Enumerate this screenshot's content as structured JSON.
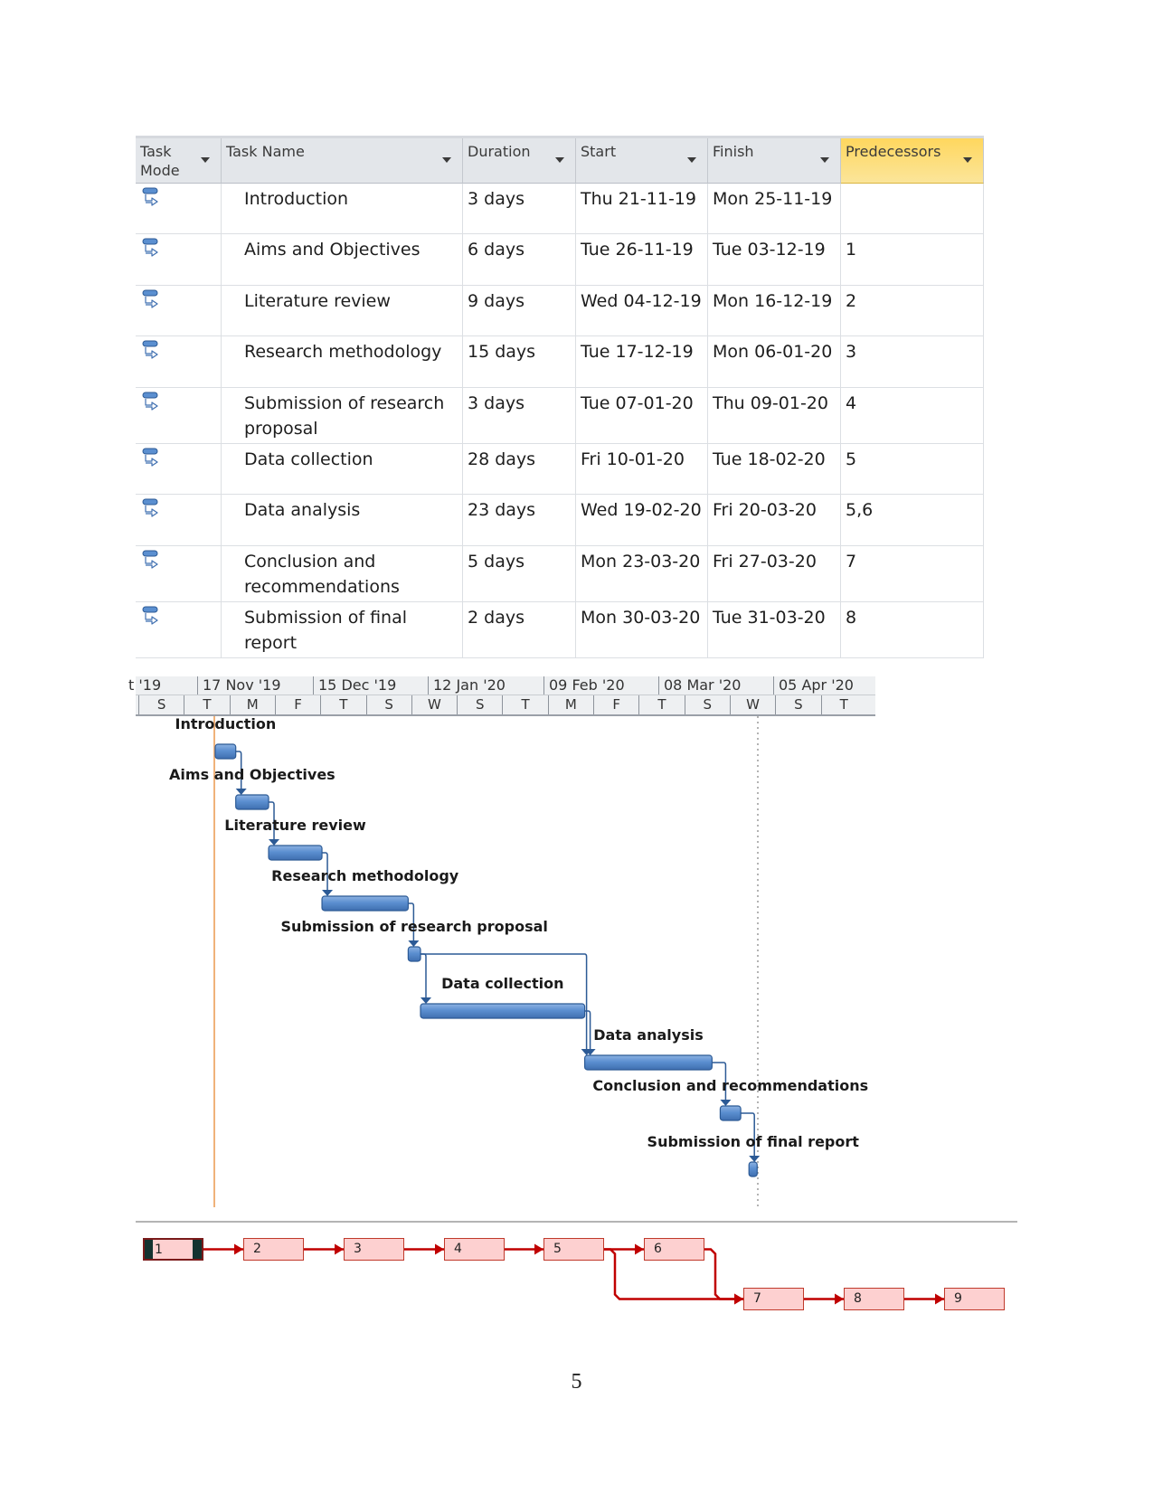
{
  "table": {
    "columns": [
      {
        "key": "mode",
        "label": "Task Mode"
      },
      {
        "key": "name",
        "label": "Task Name"
      },
      {
        "key": "duration",
        "label": "Duration"
      },
      {
        "key": "start",
        "label": "Start"
      },
      {
        "key": "finish",
        "label": "Finish"
      },
      {
        "key": "predecessors",
        "label": "Predecessors"
      }
    ],
    "header_labels": {
      "mode_line1": "Task",
      "mode_line2": "Mode",
      "name": "Task Name",
      "duration": "Duration",
      "start": "Start",
      "finish": "Finish",
      "predecessors": "Predecessors"
    },
    "rows": [
      {
        "id": 1,
        "mode": "auto-scheduled-task-icon",
        "name": "Introduction",
        "duration": "3 days",
        "start": "Thu 21-11-19",
        "finish": "Mon 25-11-19",
        "predecessors": ""
      },
      {
        "id": 2,
        "mode": "auto-scheduled-task-icon",
        "name": "Aims and Objectives",
        "duration": "6 days",
        "start": "Tue 26-11-19",
        "finish": "Tue 03-12-19",
        "predecessors": "1"
      },
      {
        "id": 3,
        "mode": "auto-scheduled-task-icon",
        "name": "Literature review",
        "duration": "9 days",
        "start": "Wed 04-12-19",
        "finish": "Mon 16-12-19",
        "predecessors": "2"
      },
      {
        "id": 4,
        "mode": "auto-scheduled-task-icon",
        "name": "Research methodology",
        "duration": "15 days",
        "start": "Tue 17-12-19",
        "finish": "Mon 06-01-20",
        "predecessors": "3"
      },
      {
        "id": 5,
        "mode": "auto-scheduled-task-icon",
        "name": "Submission of research proposal",
        "name_lines": [
          "Submission of research",
          "proposal"
        ],
        "duration": "3 days",
        "start": "Tue 07-01-20",
        "finish": "Thu 09-01-20",
        "predecessors": "4"
      },
      {
        "id": 6,
        "mode": "auto-scheduled-task-icon",
        "name": "Data collection",
        "duration": "28 days",
        "start": "Fri 10-01-20",
        "finish": "Tue 18-02-20",
        "predecessors": "5"
      },
      {
        "id": 7,
        "mode": "auto-scheduled-task-icon",
        "name": "Data analysis",
        "duration": "23 days",
        "start": "Wed 19-02-20",
        "finish": "Fri 20-03-20",
        "predecessors": "5,6"
      },
      {
        "id": 8,
        "mode": "auto-scheduled-task-icon",
        "name": "Conclusion and recommendations",
        "name_lines": [
          "Conclusion and",
          "recommendations"
        ],
        "duration": "5 days",
        "start": "Mon 23-03-20",
        "finish": "Fri 27-03-20",
        "predecessors": "7"
      },
      {
        "id": 9,
        "mode": "auto-scheduled-task-icon",
        "name": "Submission of final report",
        "name_lines": [
          "Submission of final",
          "report"
        ],
        "duration": "2 days",
        "start": "Mon 30-03-20",
        "finish": "Tue 31-03-20",
        "predecessors": "8"
      }
    ]
  },
  "timescale": {
    "top_tier": [
      "t '19",
      "17 Nov '19",
      "15 Dec '19",
      "12 Jan '20",
      "09 Feb '20",
      "08 Mar '20",
      "05 Apr '20"
    ],
    "bottom_tier": [
      "S",
      "T",
      "M",
      "F",
      "T",
      "S",
      "W",
      "S",
      "T",
      "M",
      "F",
      "T",
      "S",
      "W",
      "S",
      "T"
    ]
  },
  "gantt": {
    "bar_labels": [
      "Introduction",
      "Aims and Objectives",
      "Literature review",
      "Research methodology",
      "Submission of research proposal",
      "Data collection",
      "Data analysis",
      "Conclusion and recommendations",
      "Submission of final report"
    ],
    "colors": {
      "bar": "#4f81bd",
      "bar_border": "#2c5a95",
      "link": "#2c5a95",
      "project_start_line": "#f0b27a",
      "status_line": "#9a9a9a"
    }
  },
  "network": {
    "nodes": [
      "1",
      "2",
      "3",
      "4",
      "5",
      "6",
      "7",
      "8",
      "9"
    ],
    "selected": "1",
    "links": [
      [
        "1",
        "2"
      ],
      [
        "2",
        "3"
      ],
      [
        "3",
        "4"
      ],
      [
        "4",
        "5"
      ],
      [
        "5",
        "6"
      ],
      [
        "5",
        "7"
      ],
      [
        "6",
        "7"
      ],
      [
        "7",
        "8"
      ],
      [
        "8",
        "9"
      ]
    ],
    "colors": {
      "box_fill": "#fdd0d0",
      "box_border": "#c0392b",
      "link": "#c00000"
    }
  },
  "page": {
    "number": "5"
  }
}
